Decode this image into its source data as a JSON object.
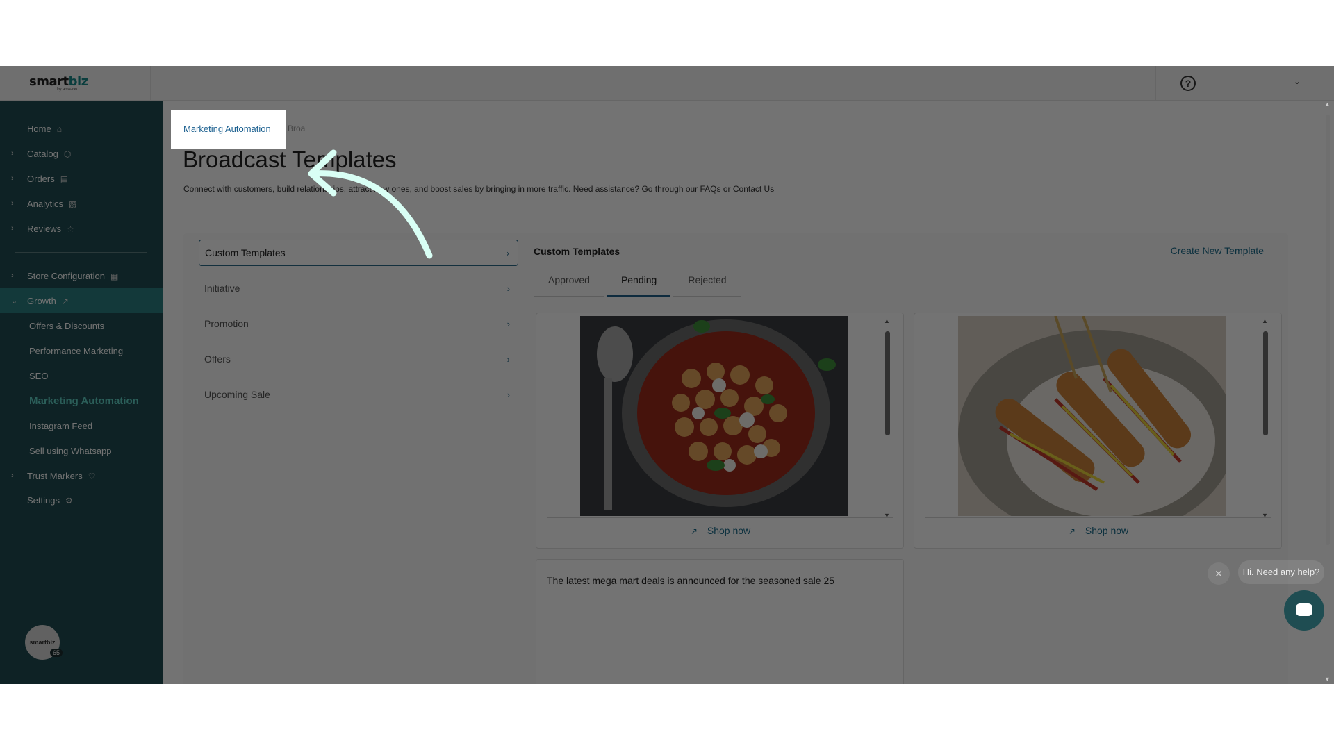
{
  "app": {
    "logo_text_1": "sm",
    "logo_text_2": "art",
    "logo_text_3": "biz",
    "logo_sub": "by amazon"
  },
  "topbar": {
    "help_icon": "question-circle-icon",
    "dropdown_icon": "chevron-down-icon"
  },
  "sidebar": {
    "items": [
      {
        "label": "Home",
        "icon": "home-icon",
        "has_chevron": false
      },
      {
        "label": "Catalog",
        "icon": "box-icon",
        "has_chevron": true
      },
      {
        "label": "Orders",
        "icon": "clipboard-icon",
        "has_chevron": true
      },
      {
        "label": "Analytics",
        "icon": "bar-chart-icon",
        "has_chevron": true
      },
      {
        "label": "Reviews",
        "icon": "star-icon",
        "has_chevron": true
      },
      {
        "label": "Store Configuration",
        "icon": "store-icon",
        "has_chevron": true
      },
      {
        "label": "Growth",
        "icon": "trending-up-icon",
        "has_chevron": true,
        "expanded": true
      },
      {
        "label": "Offers & Discounts"
      },
      {
        "label": "Performance Marketing"
      },
      {
        "label": "SEO"
      },
      {
        "label": "Marketing Automation",
        "current": true
      },
      {
        "label": "Instagram Feed"
      },
      {
        "label": "Sell using Whatsapp"
      },
      {
        "label": "Trust Markers",
        "icon": "heart-badge-icon",
        "has_chevron": true
      },
      {
        "label": "Settings",
        "icon": "gear-icon",
        "has_chevron": false
      }
    ],
    "avatar_text": "smartbiz",
    "avatar_badge": "65"
  },
  "breadcrumb": {
    "link": "Marketing Automation",
    "rest": "Broa"
  },
  "page": {
    "title": "Broadcast Templates",
    "description": "Connect with customers, build relationships, attract new ones, and boost sales by bringing in more traffic. Need assistance? Go through our FAQs or Contact Us"
  },
  "categories": [
    {
      "label": "Custom Templates",
      "selected": true
    },
    {
      "label": "Initiative"
    },
    {
      "label": "Promotion"
    },
    {
      "label": "Offers"
    },
    {
      "label": "Upcoming Sale"
    }
  ],
  "panel": {
    "title": "Custom Templates",
    "create_link": "Create New Template",
    "tabs": [
      "Approved",
      "Pending",
      "Rejected"
    ],
    "active_tab": "Pending"
  },
  "templates": [
    {
      "image_alt": "gnocchi-in-tomato-sauce-pan",
      "button": "Shop now"
    },
    {
      "image_alt": "corn-dogs-with-ketchup-mustard",
      "button": "Shop now"
    }
  ],
  "message": {
    "text": "The latest mega mart deals is announced for the seasoned sale 25"
  },
  "chat": {
    "bubble": "Hi. Need any help?",
    "close_icon": "close-icon",
    "button_icon": "chat-icon"
  },
  "colors": {
    "sidebar": "#1f4d52",
    "active_nav": "#2b7f80",
    "accent_text": "#5fd1c6",
    "link": "#1a6a8a",
    "arrow": "#d9fff5"
  }
}
